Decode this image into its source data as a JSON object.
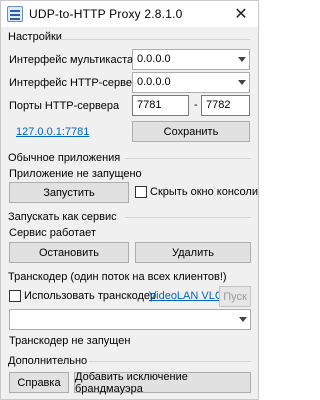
{
  "window": {
    "title": "UDP-to-HTTP Proxy 2.8.1.0",
    "close": "✕"
  },
  "settings": {
    "title": "Настройки",
    "multicast_label": "Интерфейс мультикаста",
    "multicast_value": "0.0.0.0",
    "http_iface_label": "Интерфейс HTTP-сервера",
    "http_iface_value": "0.0.0.0",
    "ports_label": "Порты HTTP-сервера",
    "port_from": "7781",
    "port_sep": "-",
    "port_to": "7782",
    "link": "127.0.0.1:7781",
    "save": "Сохранить"
  },
  "app": {
    "title": "Обычное приложения",
    "status": "Приложение не запущено",
    "start": "Запустить",
    "hide_console": "Скрыть окно консоли"
  },
  "service": {
    "title": "Запускать как сервис",
    "status": "Сервис работает",
    "stop": "Остановить",
    "remove": "Удалить"
  },
  "transcoder": {
    "title": "Транскодер (один поток на всех клиентов!)",
    "use": "Использовать транскодер",
    "vlc_link": "VideoLAN VLC",
    "browse": "Пуск",
    "path_value": "",
    "status": "Транскодер не запущен"
  },
  "extra": {
    "title": "Дополнительно",
    "help": "Справка",
    "firewall": "Добавить исключение брандмауэра"
  }
}
